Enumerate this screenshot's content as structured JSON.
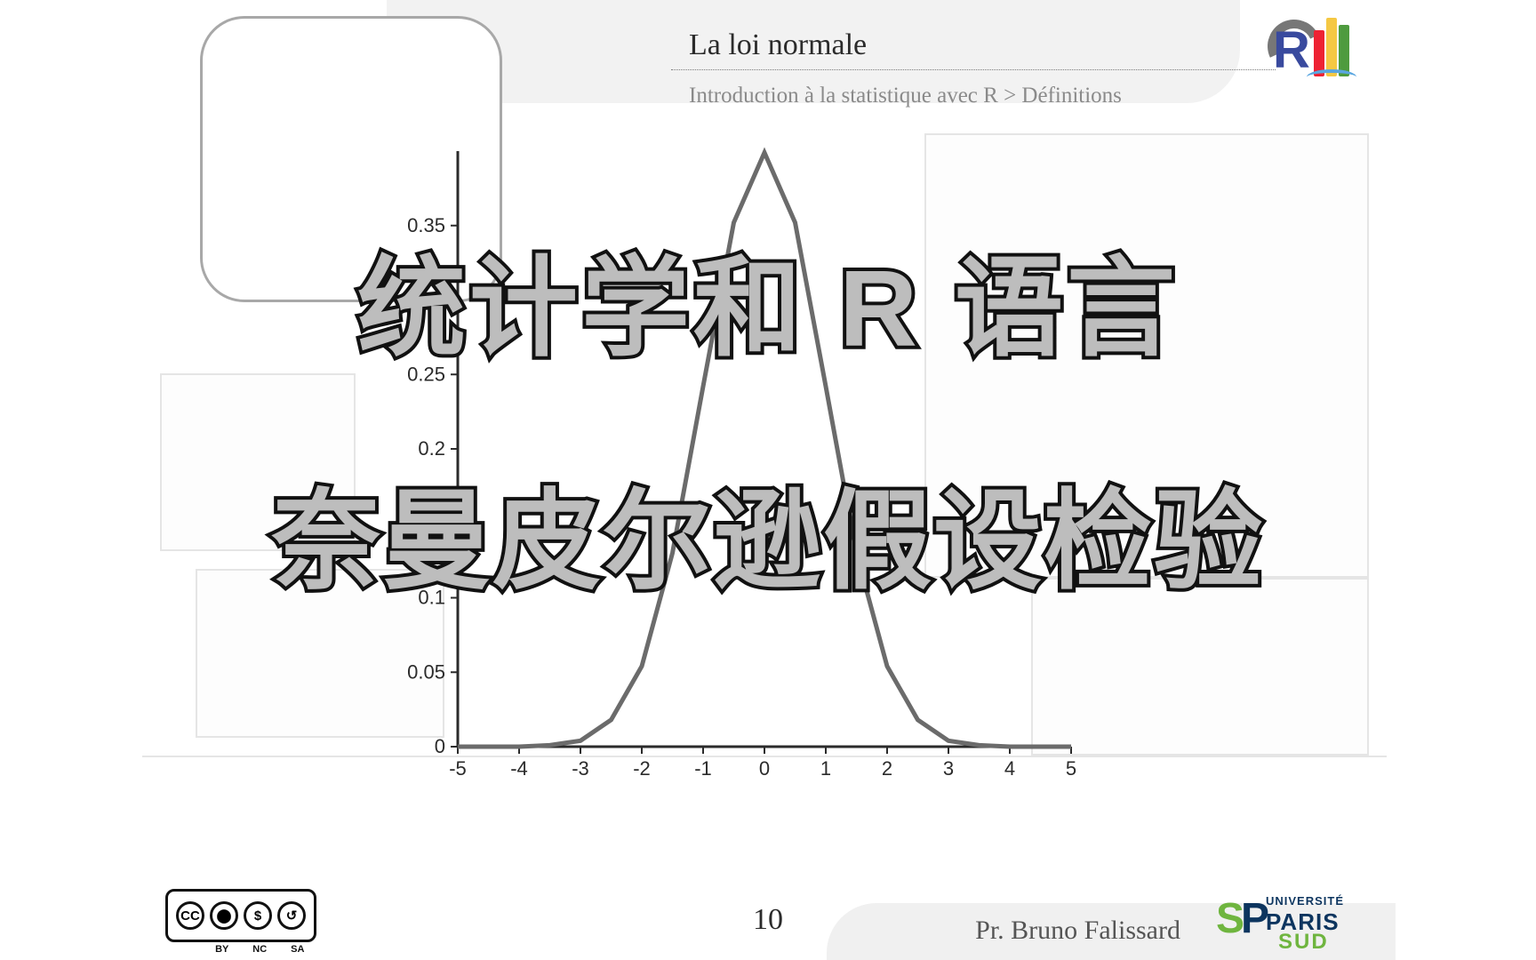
{
  "header": {
    "title": "La loi normale",
    "breadcrumb": "Introduction à la statistique avec R > Définitions"
  },
  "overlay": {
    "line1": "统计学和 R 语言",
    "line2": "奈曼皮尔逊假设检验"
  },
  "chart_data": {
    "type": "line",
    "title": "",
    "xlabel": "",
    "ylabel": "",
    "xlim": [
      -5,
      5
    ],
    "ylim": [
      0,
      0.4
    ],
    "x_ticks": [
      -5,
      -4,
      -3,
      -2,
      -1,
      0,
      1,
      2,
      3,
      4,
      5
    ],
    "y_ticks": [
      0,
      0.05,
      0.1,
      0.15,
      0.2,
      0.25,
      0.3,
      0.35
    ],
    "x": [
      -5,
      -4.5,
      -4,
      -3.5,
      -3,
      -2.5,
      -2,
      -1.5,
      -1,
      -0.5,
      0,
      0.5,
      1,
      1.5,
      2,
      2.5,
      3,
      3.5,
      4,
      4.5,
      5
    ],
    "y": [
      0.0,
      0.0,
      0.0,
      0.001,
      0.004,
      0.018,
      0.054,
      0.13,
      0.242,
      0.352,
      0.399,
      0.352,
      0.242,
      0.13,
      0.054,
      0.018,
      0.004,
      0.001,
      0.0,
      0.0,
      0.0
    ]
  },
  "footer": {
    "page": "10",
    "author": "Pr. Bruno Falissard",
    "cc_labels": [
      "BY",
      "NC",
      "SA"
    ],
    "univ": {
      "top": "UNIVERSITÉ",
      "mid": "PARIS",
      "bot": "SUD"
    }
  }
}
